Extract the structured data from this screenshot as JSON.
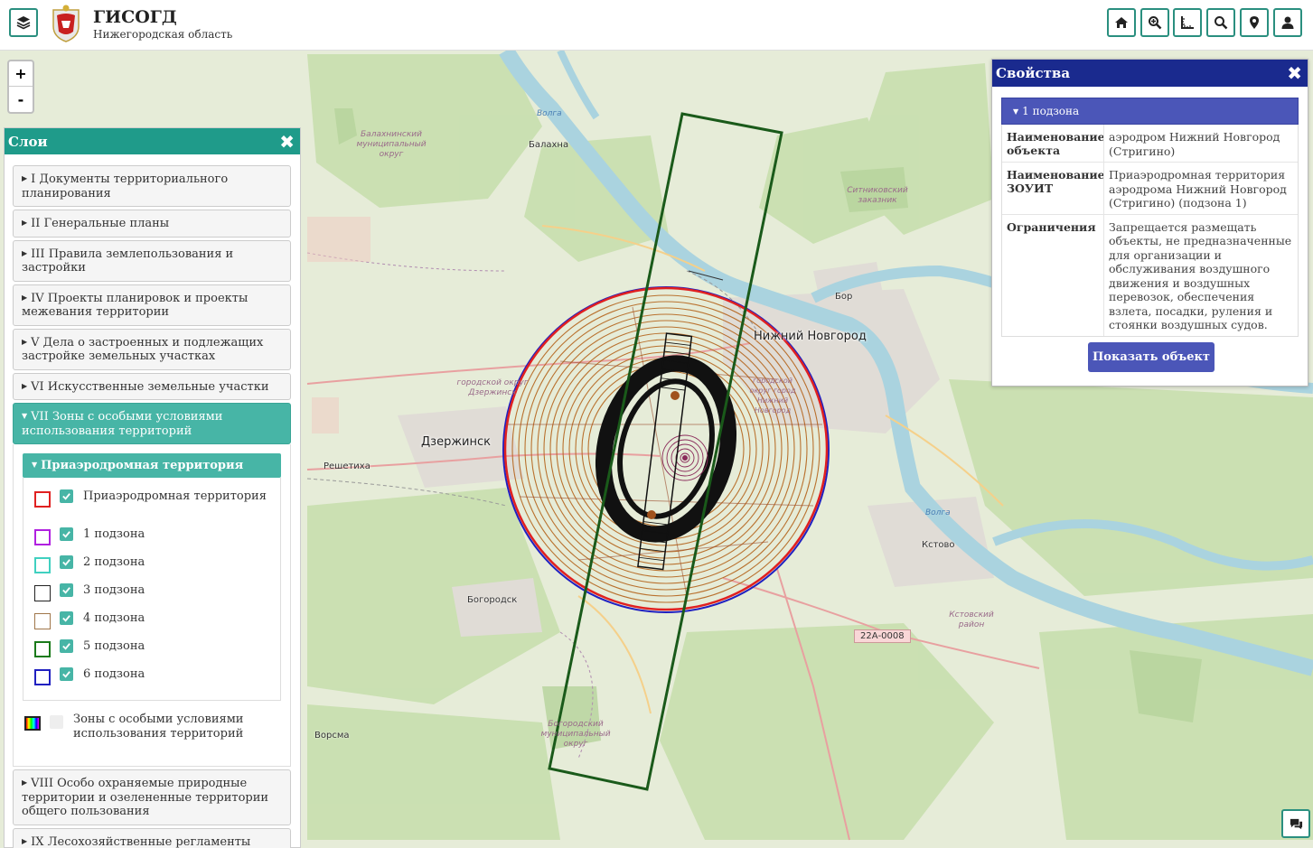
{
  "header": {
    "title": "ГИСОГД",
    "subtitle": "Нижегородская область",
    "buttons": [
      "home-icon",
      "zoom-extent-icon",
      "ruler-icon",
      "search-icon",
      "location-icon",
      "user-icon"
    ]
  },
  "map": {
    "zoom_in": "+",
    "zoom_out": "-",
    "labels": {
      "nizhny": "Нижний Новгород",
      "dzerzhinsk": "Дзержинск",
      "balakhna": "Балахна",
      "bor": "Бор",
      "kstovo": "Кстово",
      "bogorodsk": "Богородск",
      "reshetikha": "Решетиха",
      "vorsma": "Ворсма",
      "volga1": "Волга",
      "volga2": "Волга",
      "balakhna_district": "Балахнинский муниципальный округ",
      "dzerzhinsk_district": "городской округ Дзержинск",
      "bogorodsk_district": "Богородский муниципальный округ",
      "kstovo_district": "Кстовский район",
      "sitnikovsky": "Ситниковский заказник",
      "nizhny_district": "городской округ город Нижний Новгород",
      "road": "22А-0008"
    }
  },
  "layers_panel": {
    "title": "Слои",
    "close": "✖",
    "items": [
      "I Документы территориального планирования",
      "II Генеральные планы",
      "III Правила землепользования и застройки",
      "IV Проекты планировок и проекты межевания территории",
      "V Дела о застроенных и подлежащих застройке земельных участках",
      "VI Искусственные земельные участки",
      "VII Зоны с особыми условиями использования территорий",
      "VIII Особо охраняемые природные территории и озелененные территории общего пользования",
      "IX Лесохозяйственные регламенты лесничеств"
    ],
    "sublayer": {
      "title": "Приаэродромная территория",
      "legend": [
        {
          "label": "Приаэродромная территория",
          "color": "#e02020",
          "checked": true
        },
        {
          "label": "1 подзона",
          "color": "#b020e0",
          "checked": true
        },
        {
          "label": "2 подзона",
          "color": "#40d0c0",
          "checked": true
        },
        {
          "label": "3 подзона",
          "color": "#222222",
          "checked": true
        },
        {
          "label": "4 подзона",
          "color": "#a0764a",
          "checked": true
        },
        {
          "label": "5 подзона",
          "color": "#1a7a1a",
          "checked": true
        },
        {
          "label": "6 подзона",
          "color": "#2020c0",
          "checked": true
        }
      ]
    },
    "extra": {
      "label": "Зоны с особыми условиями использования территорий",
      "checked": false
    }
  },
  "properties": {
    "title": "Свойства",
    "close": "✖",
    "section": "1 подзона",
    "rows": [
      {
        "key": "Наименование объекта",
        "value": "аэродром Нижний Новгород (Стригино)"
      },
      {
        "key": "Наименование ЗОУИТ",
        "value": "Приаэродромная территория аэродрома Нижний Новгород (Стригино) (подзона 1)"
      },
      {
        "key": "Ограничения",
        "value": "Запрещается размещать объекты, не предназначенные для организации и обслуживания воздушного движения и воздушных перевозок, обеспечения взлета, посадки, руления и стоянки воздушных судов."
      }
    ],
    "show_button": "Показать объект"
  }
}
